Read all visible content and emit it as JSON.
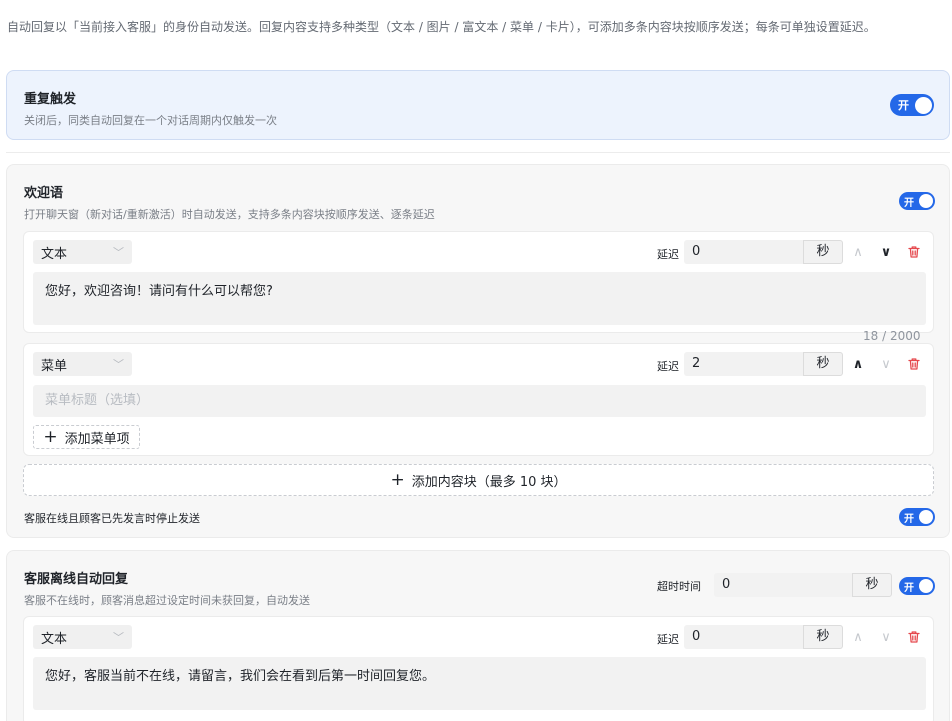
{
  "intro": "自动回复以「当前接入客服」的身份自动发送。回复内容支持多种类型（文本 / 图片 / 富文本 / 菜单 / 卡片），可添加多条内容块按顺序发送；每条可单独设置延迟。",
  "repeat": {
    "title": "重复触发",
    "desc": "关闭后，同类自动回复在一个对话周期内仅触发一次",
    "switch_label": "开"
  },
  "welcome": {
    "title": "欢迎语",
    "desc": "打开聊天窗（新对话/重新激活）时自动发送，支持多条内容块按顺序发送、逐条延迟",
    "switch_label": "开",
    "blocks": [
      {
        "type": "文本",
        "delay_label": "延迟",
        "delay_value": "0",
        "unit": "秒",
        "content": "您好，欢迎咨询！请问有什么可以帮您?",
        "counter": "18 / 2000"
      },
      {
        "type": "菜单",
        "delay_label": "延迟",
        "delay_value": "2",
        "unit": "秒",
        "title_placeholder": "菜单标题（选填）",
        "add_item_label": "添加菜单项"
      }
    ],
    "add_block_label": "添加内容块（最多 10 块）",
    "stop_label": "客服在线且顾客已先发言时停止发送",
    "stop_switch_label": "开"
  },
  "offline": {
    "title": "客服离线自动回复",
    "desc": "客服不在线时，顾客消息超过设定时间未获回复，自动发送",
    "timeout_label": "超时时间",
    "timeout_value": "0",
    "timeout_unit": "秒",
    "switch_label": "开",
    "blocks": [
      {
        "type": "文本",
        "delay_label": "延迟",
        "delay_value": "0",
        "unit": "秒",
        "content": "您好，客服当前不在线，请留言，我们会在看到后第一时间回复您。"
      }
    ]
  },
  "icons": {
    "chevron": "chevron-down-icon",
    "up": "arrow-up-icon",
    "down": "arrow-down-icon",
    "delete": "trash-icon",
    "add": "plus-icon"
  },
  "colors": {
    "accent": "#2468e8",
    "danger": "#e5484d",
    "highlight_bg": "#edf3fd"
  }
}
